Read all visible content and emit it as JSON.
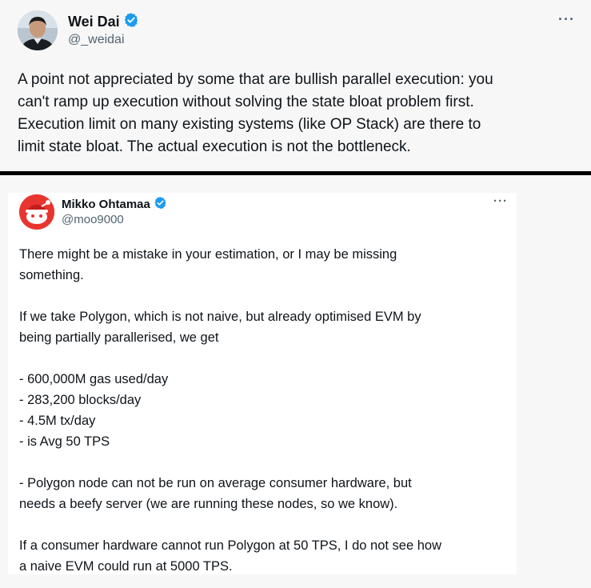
{
  "tweet1": {
    "author": {
      "name": "Wei Dai",
      "handle": "@_weidai"
    },
    "more_label": "···",
    "text": "A point not appreciated by some that are bullish parallel execution: you\ncan't ramp up execution without solving the state bloat problem first.\nExecution limit on many existing systems (like OP Stack) are there to\nlimit state bloat. The actual execution is not the bottleneck."
  },
  "tweet2": {
    "author": {
      "name": "Mikko Ohtamaa",
      "handle": "@moo9000"
    },
    "more_label": "···",
    "text": "There might be a mistake in your estimation, or I may be missing\nsomething.\n\nIf we take Polygon, which is not naive, but already optimised EVM by\nbeing partially parallerised, we get\n\n- 600,000M gas used/day\n- 283,200 blocks/day\n- 4.5M tx/day\n- is Avg 50 TPS\n\n- Polygon node can not be run on average consumer hardware, but\nneeds a beefy server (we are running these nodes, so we know).\n\nIf a consumer hardware cannot run Polygon at 50 TPS, I do not see how\na naive EVM could run at 5000 TPS."
  },
  "colors": {
    "verified": "#1d9bf0",
    "avatar2_bg": "#e8342f",
    "divider": "#000000"
  },
  "icons": [
    "verified-badge-icon",
    "more-options-icon"
  ]
}
